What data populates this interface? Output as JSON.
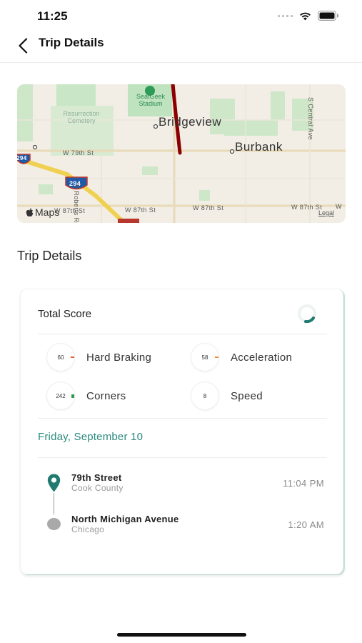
{
  "status_bar": {
    "time": "11:25"
  },
  "nav": {
    "title": "Trip Details"
  },
  "map": {
    "cities": [
      "Bridgeview",
      "Burbank"
    ],
    "stadium": [
      "SeatGeek",
      "Stadium"
    ],
    "cemetery": [
      "Resurrection",
      "Cemetery"
    ],
    "streets": {
      "w79": "W 79th St",
      "w87_a": "W 87th St",
      "w87_b": "W 87th St",
      "w87_c": "W 87th St",
      "w87_d": "W 87th St",
      "roberts": "S Roberts Rd",
      "central": "S Central Ave",
      "w_edge": "W"
    },
    "shields": [
      "294",
      "294"
    ],
    "maps_brand": "Maps",
    "legal": "Legal",
    "route_color": "#8b0000"
  },
  "section_title": "Trip Details",
  "card": {
    "total_score_label": "Total Score",
    "metrics": [
      {
        "value": "60",
        "label": "Hard Braking",
        "mark_color": "#e8553b"
      },
      {
        "value": "58",
        "label": "Acceleration",
        "mark_color": "#f08a35"
      },
      {
        "value": "242",
        "label": "Corners",
        "mark_color": "#2e9a4c"
      },
      {
        "value": "8",
        "label": "Speed",
        "mark_color": ""
      }
    ],
    "date": "Friday, September 10",
    "origin": {
      "name": "79th Street",
      "sub": "Cook County",
      "time": "11:04 PM"
    },
    "destination": {
      "name": "North Michigan Avenue",
      "sub": "Chicago",
      "time": "1:20 AM"
    },
    "accent_color": "#2a8a7e"
  }
}
